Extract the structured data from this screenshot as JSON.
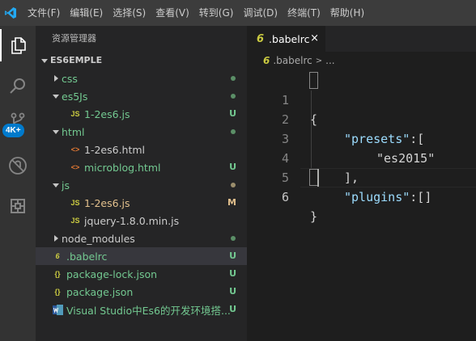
{
  "menu": {
    "items": [
      "文件(F)",
      "编辑(E)",
      "选择(S)",
      "查看(V)",
      "转到(G)",
      "调试(D)",
      "终端(T)",
      "帮助(H)"
    ]
  },
  "activity": {
    "badge": "4K+"
  },
  "sidebar": {
    "title": "资源管理器",
    "section": "ES6EMPLE",
    "items": [
      {
        "label": "css",
        "kind": "folder",
        "status": "dot"
      },
      {
        "label": "es5Js",
        "kind": "folder-open",
        "status": "dot"
      },
      {
        "label": "1-2es6.js",
        "kind": "js",
        "status": "U"
      },
      {
        "label": "html",
        "kind": "folder-open",
        "status": "dot"
      },
      {
        "label": "1-2es6.html",
        "kind": "html",
        "status": ""
      },
      {
        "label": "microblog.html",
        "kind": "html",
        "status": "U"
      },
      {
        "label": "js",
        "kind": "folder-open",
        "status": "dot"
      },
      {
        "label": "1-2es6.js",
        "kind": "js",
        "status": "M"
      },
      {
        "label": "jquery-1.8.0.min.js",
        "kind": "js",
        "status": ""
      },
      {
        "label": "node_modules",
        "kind": "folder",
        "status": "dot"
      },
      {
        "label": ".babelrc",
        "kind": "babel",
        "status": "U"
      },
      {
        "label": "package-lock.json",
        "kind": "json",
        "status": "U"
      },
      {
        "label": "package.json",
        "kind": "json",
        "status": "U"
      },
      {
        "label": "Visual Studio中Es6的开发环境搭...",
        "kind": "vs",
        "status": "U"
      }
    ],
    "icons": {
      "js": "JS",
      "json": "{}",
      "html": "<>",
      "babel": "6"
    }
  },
  "editor": {
    "tab_label": ".babelrc",
    "tab_close": "×",
    "breadcrumb_file": ".babelrc",
    "breadcrumb_sep": ">",
    "breadcrumb_more": "...",
    "line_numbers": [
      "1",
      "2",
      "3",
      "4",
      "5",
      "6"
    ],
    "code": {
      "l1": "{",
      "l2_key": "\"presets\"",
      "l2_rest": ":[",
      "l3_str": "\"es2015\"",
      "l4": "],",
      "l5_key": "\"plugins\"",
      "l5_rest": ":[]",
      "l6": "}"
    }
  },
  "colors": {
    "accent": "#007acc",
    "untracked": "#73c991",
    "modified": "#e2c08d"
  }
}
